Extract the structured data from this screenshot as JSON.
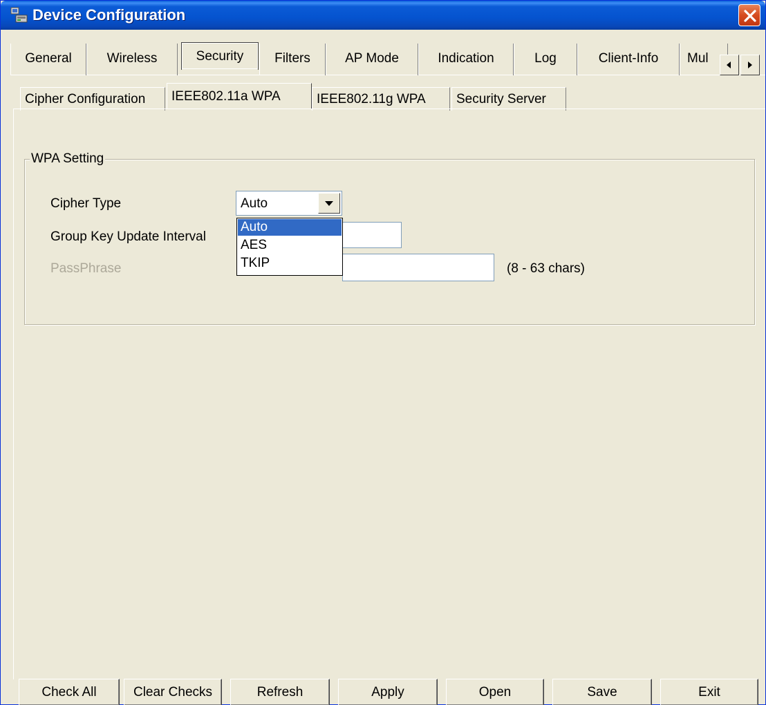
{
  "window": {
    "title": "Device Configuration"
  },
  "main_tabs": [
    "General",
    "Wireless",
    "Security",
    "Filters",
    "AP Mode",
    "Indication",
    "Log",
    "Client-Info",
    "Mul"
  ],
  "main_tab_active": "Security",
  "sub_tabs": [
    "Cipher Configuration",
    "IEEE802.11a WPA",
    "IEEE802.11g WPA",
    "Security Server"
  ],
  "sub_tab_active": "IEEE802.11a WPA",
  "group": {
    "legend": "WPA Setting",
    "cipher_type_label": "Cipher Type",
    "cipher_type_value": "Auto",
    "cipher_options": [
      "Auto",
      "AES",
      "TKIP"
    ],
    "group_key_label": "Group Key Update Interval",
    "group_key_value": "",
    "passphrase_label": "PassPhrase",
    "passphrase_value": "",
    "passphrase_hint": "(8 - 63 chars)"
  },
  "buttons": [
    "Check All",
    "Clear Checks",
    "Refresh",
    "Apply",
    "Open",
    "Save",
    "Exit"
  ],
  "colors": {
    "titlebar": "#0553cf",
    "selection": "#316ac5",
    "face": "#ece9d8",
    "close": "#d64b1f"
  },
  "icons": {
    "title": "network-device-icon",
    "close": "close-icon",
    "scroll_left": "arrow-left-icon",
    "scroll_right": "arrow-right-icon",
    "dropdown": "chevron-down-icon"
  }
}
